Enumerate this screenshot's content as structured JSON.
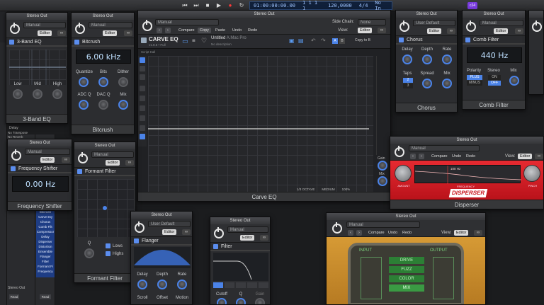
{
  "transport": {
    "time": "01:00:00:00.00",
    "bars": "1 1 1 1",
    "tempo": "120,0000",
    "signature": "4/4",
    "input": "No In",
    "cpu": "c24"
  },
  "common": {
    "stereo_out": "Stereo Out",
    "manual": "Manual",
    "user_default": "User Default",
    "editor": "Editor",
    "view": "View:",
    "compare": "Compare",
    "copy": "Copy",
    "paste": "Paste",
    "undo": "Undo",
    "redo": "Redo",
    "link": "∞"
  },
  "eq3": {
    "title": "3-Band EQ",
    "labels": [
      "Low",
      "Mid",
      "High"
    ],
    "footer": "3-Band EQ"
  },
  "bitcrush": {
    "title": "Bitcrush",
    "display": "6.00 kHz",
    "row1": [
      "Quantize",
      "Bits",
      "Dither"
    ],
    "row2": [
      "ADC Q",
      "DAC Q",
      "Mix"
    ],
    "footer": "Bitcrush"
  },
  "carve": {
    "title": "CARVE EQ",
    "version": "v1.8.5 • Full",
    "preset": "Untitled",
    "author": "A.Mac Pro",
    "desc": "No description",
    "side_chain_label": "Side Chain:",
    "side_chain": "None",
    "script_label": "Script Kall",
    "copy_to": "Copy to B",
    "ab": [
      "A",
      "B"
    ],
    "bottom": [
      "1/3 OCTAVE",
      "MEDIUM",
      "100%"
    ],
    "gain_label": "Gain",
    "mix_label": "Mix",
    "footer": "Carve EQ"
  },
  "chorus": {
    "title": "Chorus",
    "row1": [
      "Delay",
      "Depth",
      "Rate"
    ],
    "row2": [
      "Taps",
      "Spread",
      "Mix"
    ],
    "taps": [
      "2",
      "3"
    ],
    "footer": "Chorus"
  },
  "comb": {
    "title": "Comb Filter",
    "display": "440 Hz",
    "labels": [
      "Polarity",
      "Stereo",
      "Mix"
    ],
    "polarity": [
      "PLUS",
      "MINUS"
    ],
    "stereo": [
      "ON",
      "OFF"
    ],
    "footer": "Comb Filter"
  },
  "freqshift": {
    "title": "Frequency Shifter",
    "display": "0.00 Hz",
    "footer": "Frequency Shifter"
  },
  "formant": {
    "title": "Formant Filter",
    "q_label": "Q",
    "lows": "Lows",
    "highs": "Highs",
    "footer": "Formant Filter"
  },
  "flanger": {
    "title": "Flanger",
    "row1": [
      "Delay",
      "Depth",
      "Rate"
    ],
    "row2": [
      "Scroll",
      "Offset",
      "Motion"
    ],
    "footer": ""
  },
  "filter": {
    "title": "Filter",
    "labels": [
      "Cutoff",
      "Q",
      "Gain"
    ]
  },
  "disperser": {
    "knob_labels": [
      "AMOUNT",
      "FREQUENCY",
      "PINCH"
    ],
    "freq_readout": "100 Hz",
    "logo": "DISPERSER",
    "footer": "Disperser"
  },
  "crt": {
    "input_label": "INPUT",
    "output_label": "OUTPUT",
    "buttons": [
      "DRIVE",
      "FUZZ",
      "COLOR",
      "MIX"
    ]
  },
  "mixer": {
    "strip_labels": [
      "Delay",
      "No Transpose",
      "No Reverb"
    ],
    "plugins": [
      "Bitcrush",
      "Carve EQ",
      "Chorus",
      "Comb Filt",
      "Compressor",
      "Delay",
      "Disperser",
      "Distortion",
      "Ensemble",
      "Flanger",
      "Filter",
      "Formant Fi",
      "Frequency"
    ],
    "out_label": "Stereo Out",
    "read_labels": [
      "Read",
      "Read"
    ],
    "group_label": "Group"
  },
  "colors": {
    "accent": "#4b83e8",
    "disperser_red": "#e0202b",
    "crt_amber": "#c9922e",
    "crt_green": "#3a9a43",
    "lcd_blue": "#9fc4ff"
  }
}
